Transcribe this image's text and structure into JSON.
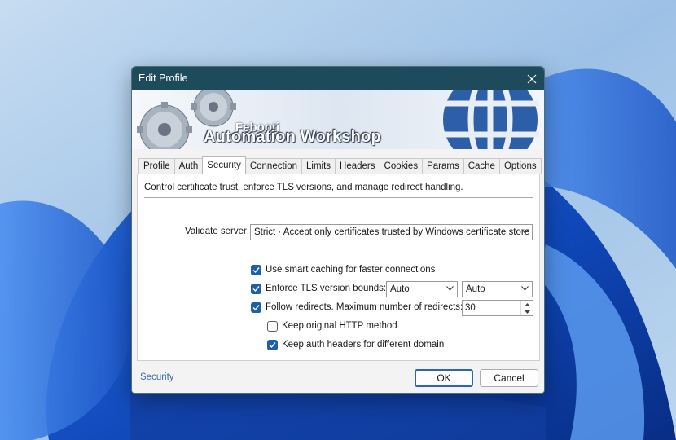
{
  "window": {
    "title": "Edit Profile"
  },
  "banner": {
    "brand_small": "Febooti",
    "brand_large": "Automation Workshop"
  },
  "tabs": [
    {
      "label": "Profile"
    },
    {
      "label": "Auth"
    },
    {
      "label": "Security"
    },
    {
      "label": "Connection"
    },
    {
      "label": "Limits"
    },
    {
      "label": "Headers"
    },
    {
      "label": "Cookies"
    },
    {
      "label": "Params"
    },
    {
      "label": "Cache"
    },
    {
      "label": "Options"
    }
  ],
  "active_tab": "Security",
  "security": {
    "description": "Control certificate trust, enforce TLS versions, and manage redirect handling.",
    "validate_server_label": "Validate server:",
    "validate_server_value": "Strict · Accept only certificates trusted by Windows certificate store",
    "smart_caching": {
      "label": "Use smart caching for faster connections",
      "checked": true
    },
    "tls_bounds": {
      "label": "Enforce TLS version bounds:",
      "checked": true,
      "min": "Auto",
      "max": "Auto"
    },
    "follow_redirects": {
      "label": "Follow redirects. Maximum number of redirects:",
      "checked": true,
      "max": "30"
    },
    "keep_http_method": {
      "label": "Keep original HTTP method",
      "checked": false
    },
    "keep_auth_headers": {
      "label": "Keep auth headers for different domain",
      "checked": true
    }
  },
  "footer": {
    "link": "Security",
    "ok": "OK",
    "cancel": "Cancel"
  },
  "colors": {
    "titlebar": "#1d4b5c",
    "accent": "#1f5ea8",
    "link": "#3f6db0"
  }
}
